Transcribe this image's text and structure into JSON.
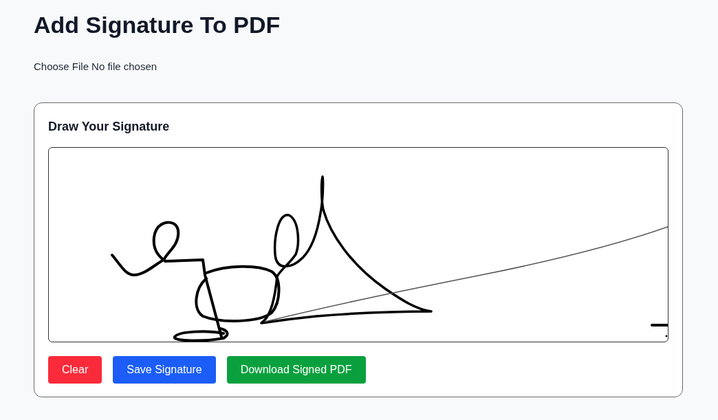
{
  "page": {
    "title": "Add Signature To PDF"
  },
  "file_input": {
    "button_label": "Choose File",
    "status": "No file chosen"
  },
  "signature_card": {
    "title": "Draw Your Signature",
    "buttons": [
      {
        "label": "Clear",
        "kind": "danger"
      },
      {
        "label": "Save Signature",
        "kind": "primary"
      },
      {
        "label": "Download Signed PDF",
        "kind": "success"
      }
    ]
  }
}
